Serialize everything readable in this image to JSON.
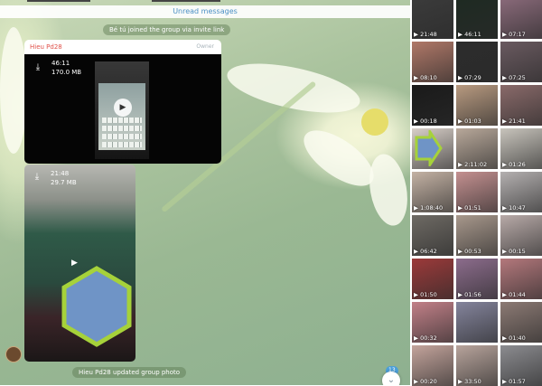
{
  "chat": {
    "unread_label": "Unread messages",
    "joined_text": "Bé tú joined the group via invite link",
    "updated_text": "Hieu Pd28 updated group photo",
    "message": {
      "sender": "Hieu Pd28",
      "role": "Owner",
      "video1": {
        "duration": "46:11",
        "size": "170.0 MB"
      },
      "video2": {
        "duration": "21:48",
        "size": "29.7 MB"
      }
    },
    "unread_count": "13"
  },
  "icons": {
    "download": "download-icon",
    "play": "play-icon",
    "scroll_down": "chevron-down-icon"
  },
  "media_panel": {
    "thumbnails": [
      {
        "duration": "21:48",
        "color": "#3b3b3b"
      },
      {
        "duration": "46:11",
        "color": "#1e2a22"
      },
      {
        "duration": "07:17",
        "color": "#8a6a7a"
      },
      {
        "duration": "08:10",
        "color": "#b07868"
      },
      {
        "duration": "07:29",
        "color": "#2c2c2c"
      },
      {
        "duration": "07:25",
        "color": "#6a5a60"
      },
      {
        "duration": "00:18",
        "color": "#1a1a1a"
      },
      {
        "duration": "01:03",
        "color": "#b89a80"
      },
      {
        "duration": "21:41",
        "color": "#8a6a6a"
      },
      {
        "duration": "",
        "color": "#d8cfc8"
      },
      {
        "duration": "2:11:02",
        "color": "#b8a89a"
      },
      {
        "duration": "01:26",
        "color": "#c8c4bc"
      },
      {
        "duration": "1:08:40",
        "color": "#c4b2a4"
      },
      {
        "duration": "01:51",
        "color": "#c49090"
      },
      {
        "duration": "10:47",
        "color": "#b4b0b0"
      },
      {
        "duration": "06:42",
        "color": "#6e6a64"
      },
      {
        "duration": "00:53",
        "color": "#a8988c"
      },
      {
        "duration": "00:15",
        "color": "#b8aaa8"
      },
      {
        "duration": "01:50",
        "color": "#9c3a3a"
      },
      {
        "duration": "01:56",
        "color": "#8c6c8c"
      },
      {
        "duration": "01:44",
        "color": "#b4787c"
      },
      {
        "duration": "00:32",
        "color": "#c28088"
      },
      {
        "duration": "",
        "color": "#84849c"
      },
      {
        "duration": "01:40",
        "color": "#8c7a74"
      },
      {
        "duration": "00:20",
        "color": "#c4a49c"
      },
      {
        "duration": "33:50",
        "color": "#b8a49c"
      },
      {
        "duration": "01:57",
        "color": "#8c8c90"
      }
    ]
  },
  "colors": {
    "sender": "#e0514a",
    "link": "#4a8fc4",
    "redaction_fill": "#6f94c6",
    "redaction_stroke": "#a6d23a"
  }
}
